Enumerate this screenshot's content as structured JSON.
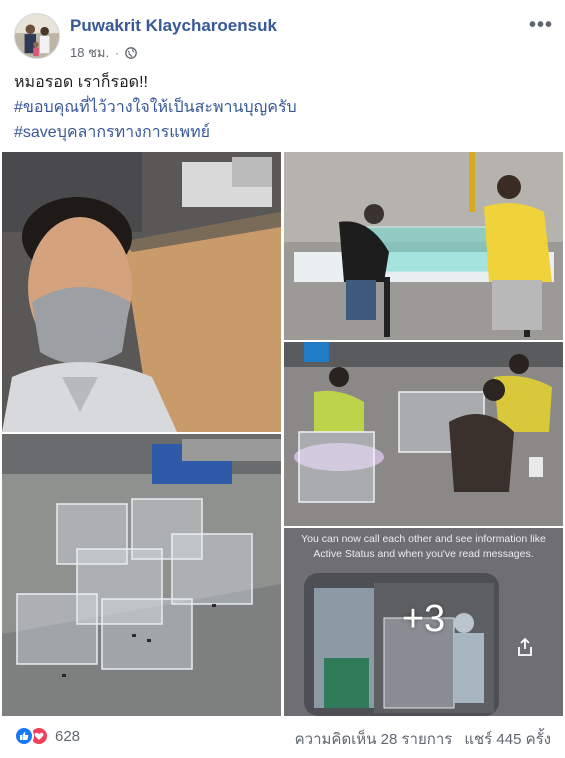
{
  "post": {
    "author": "Puwakrit Klaycharoensuk",
    "timestamp": "18 ชม.",
    "privacy_icon": "globe-icon",
    "more_icon": "more-icon",
    "text_lines": [
      {
        "text": "หมอรอด เราก็รอด!!",
        "kind": "plain"
      },
      {
        "text": "#ขอบคุณที่ไว้วางใจให้เป็นสะพานบุญครับ",
        "kind": "tag"
      },
      {
        "text": "#saveบุคลากรทางการแพทย์",
        "kind": "tag"
      }
    ]
  },
  "photos": {
    "more_count": "+3",
    "screen_text": "You can now call each other and see information like Active Status and when you've read messages."
  },
  "footer": {
    "reaction_count": "628",
    "comments": "ความคิดเห็น 28 รายการ",
    "shares": "แชร์ 445 ครั้ง"
  },
  "colors": {
    "link": "#385898",
    "like": "#1877f2",
    "love": "#f33e58",
    "meta": "#606770"
  }
}
